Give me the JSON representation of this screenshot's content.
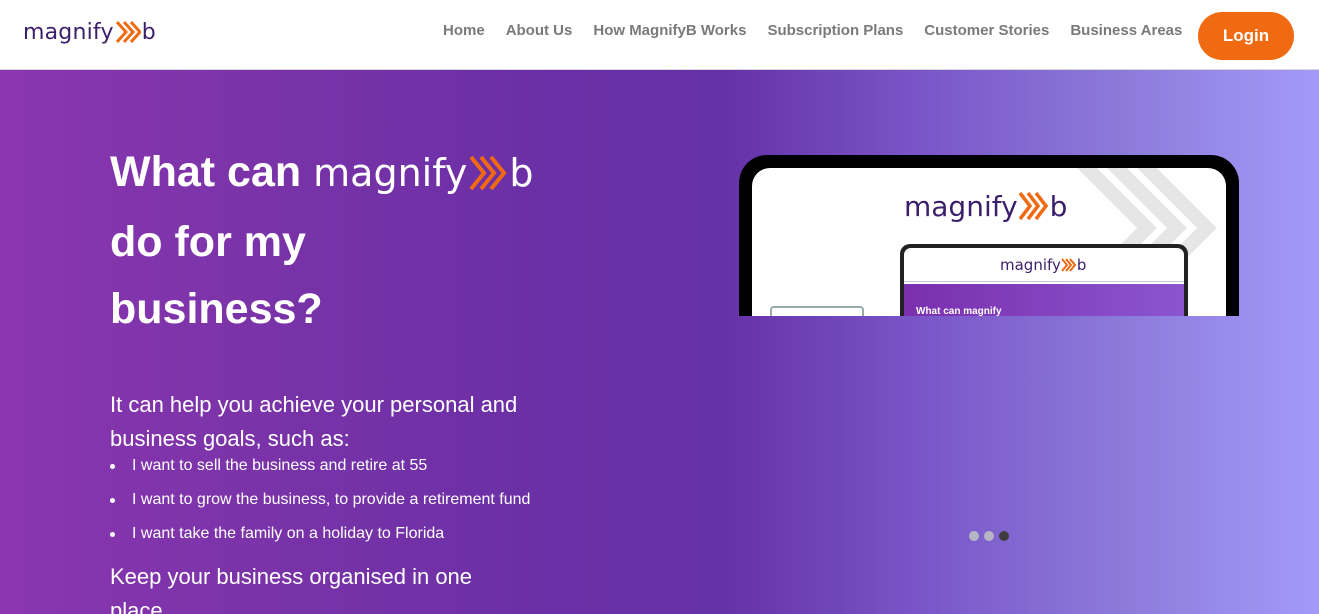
{
  "brand": {
    "logo_text": "magnify",
    "logo_suffix": "b"
  },
  "nav": {
    "items": [
      "Home",
      "About Us",
      "How MagnifyB Works",
      "Subscription Plans",
      "Customer Stories",
      "Business Areas"
    ],
    "login_label": "Login"
  },
  "hero": {
    "heading_part1": "What can",
    "heading_logo": "magnify",
    "heading_logo_suffix": "b",
    "heading_line2": "do for my",
    "heading_line3": "business?",
    "intro": "It can help you achieve your personal and business goals, such as:",
    "goals": [
      "I want to sell the business and retire at 55",
      "I want to grow the business, to provide a retirement fund",
      "I want take the family on a holiday to Florida"
    ],
    "keep": "Keep your business organised in one place"
  },
  "mockup": {
    "logo_text": "magnify",
    "logo_suffix": "b",
    "inner_logo_text": "magnify",
    "inner_logo_suffix": "b",
    "inner_heading": "What can magnify"
  },
  "carousel": {
    "dot_count": 3,
    "active_index": 2
  },
  "colors": {
    "accent": "#ef6a10",
    "brand_purple": "#3b1f6b",
    "nav_text": "#7a7a7a"
  }
}
